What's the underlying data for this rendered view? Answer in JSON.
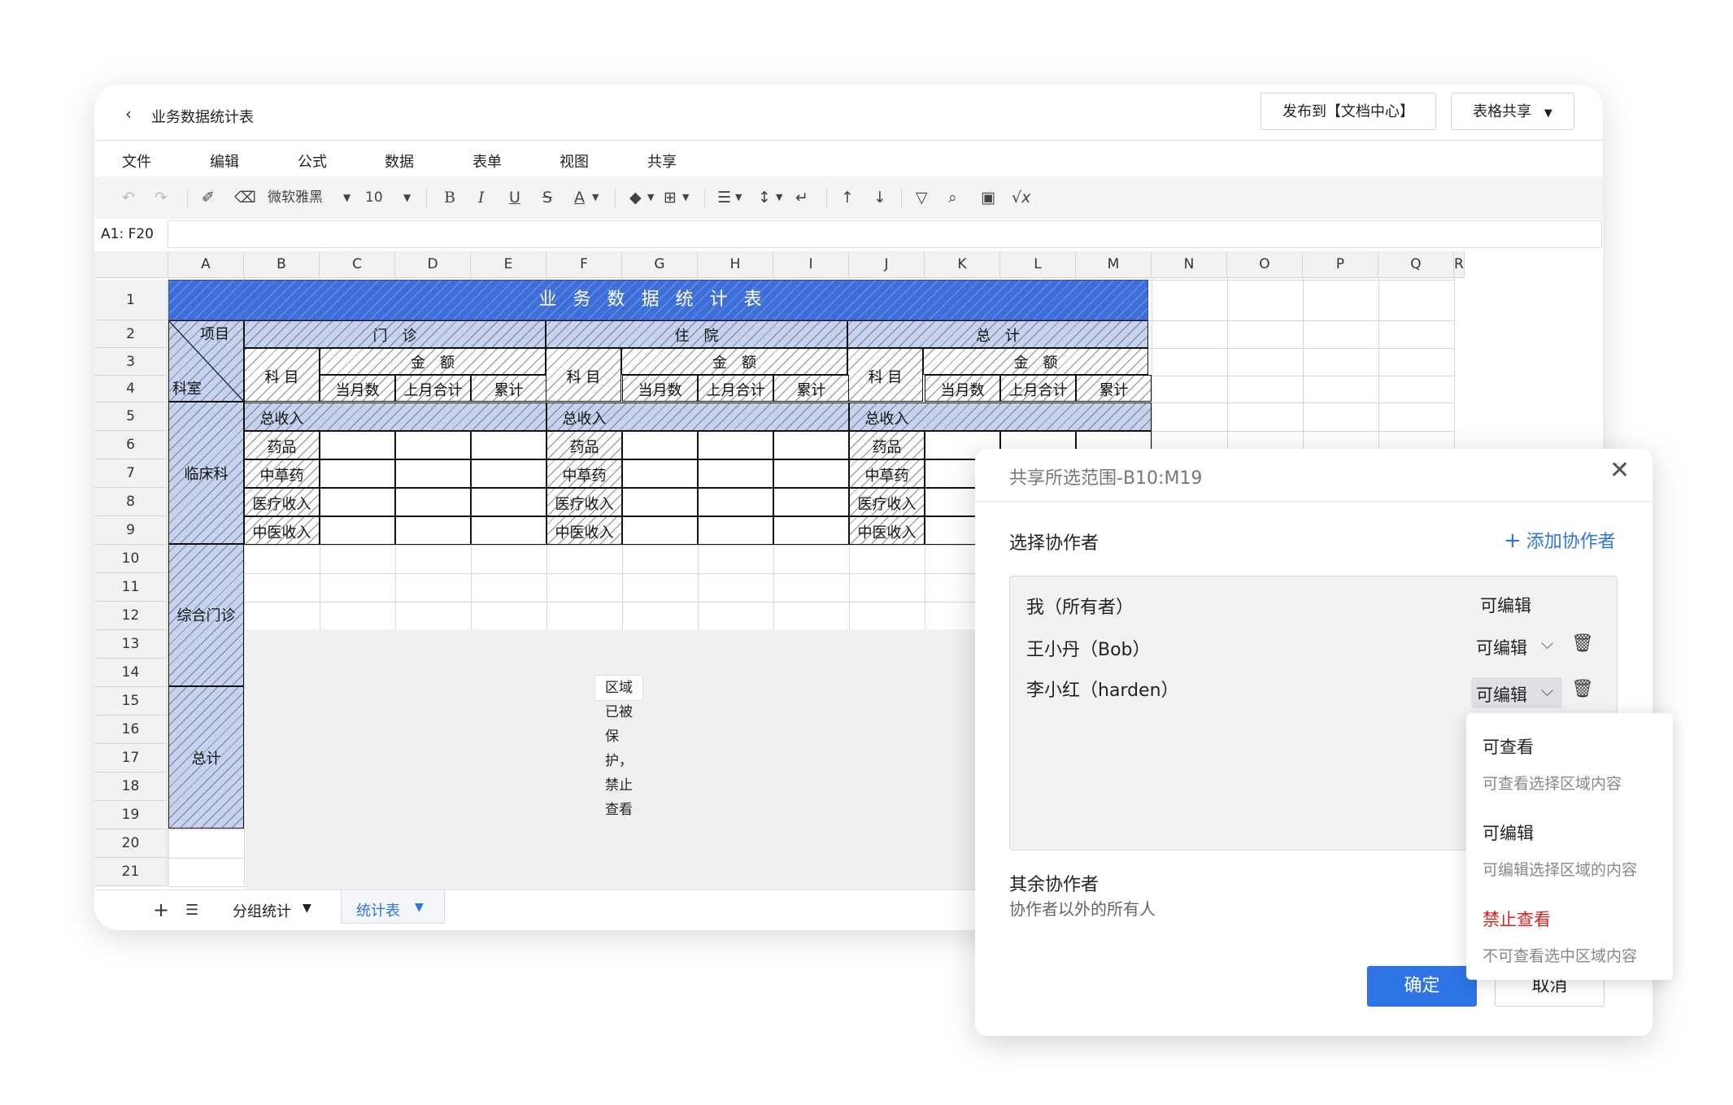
{
  "window": {
    "title": "业务数据统计表",
    "publish_label": "发布到【文档中心】",
    "share_label": "表格共享"
  },
  "menus": [
    "文件",
    "编辑",
    "公式",
    "数据",
    "表单",
    "视图",
    "共享"
  ],
  "toolbar": {
    "font_name": "微软雅黑",
    "font_size": "10"
  },
  "formula_bar": {
    "cell_ref": "A1: F20",
    "value": ""
  },
  "columns": [
    "A",
    "B",
    "C",
    "D",
    "E",
    "F",
    "G",
    "H",
    "I",
    "J",
    "K",
    "L",
    "M",
    "N",
    "O",
    "P",
    "Q",
    "R"
  ],
  "rows": [
    "1",
    "2",
    "3",
    "4",
    "5",
    "6",
    "7",
    "8",
    "9",
    "10",
    "11",
    "12",
    "13",
    "14",
    "15",
    "16",
    "17",
    "18",
    "19",
    "20",
    "21"
  ],
  "sheet": {
    "title": "业务数据统计表",
    "header_item": "项目",
    "header_dept": "科室",
    "section_outpatient": "门　诊",
    "section_inpatient": "住　院",
    "section_total": "总　计",
    "subject": "科 目",
    "amount": "金　额",
    "month": "当月数",
    "last_month": "上月合计",
    "cumulative": "累计",
    "total_income": "总收入",
    "items": [
      "药品",
      "中草药",
      "医疗收入",
      "中医收入"
    ],
    "dept_clinical": "临床科",
    "dept_general": "综合门诊",
    "dept_total": "总计",
    "protected_message": "区域已被保护，禁止查看"
  },
  "tabs": {
    "add": "+",
    "list": "☰",
    "tab1": "分组统计",
    "tab2": "统计表"
  },
  "dialog": {
    "title": "共享所选范围-B10:M19",
    "select_label": "选择协作者",
    "add_label": "添加协作者",
    "collaborators": [
      {
        "name": "我（所有者）",
        "permission": "可编辑"
      },
      {
        "name": "王小丹（Bob）",
        "permission": "可编辑"
      },
      {
        "name": "李小红（harden）",
        "permission": "可编辑"
      }
    ],
    "others_label": "其余协作者",
    "others_desc": "协作者以外的所有人",
    "confirm": "确定",
    "cancel": "取消"
  },
  "dropdown": {
    "options": [
      {
        "title": "可查看",
        "desc": "可查看选择区域内容",
        "color": "#222222"
      },
      {
        "title": "可编辑",
        "desc": "可编辑选择区域的内容",
        "color": "#222222"
      },
      {
        "title": "禁止查看",
        "desc": "不可查看选中区域内容",
        "color": "#e02020"
      }
    ]
  },
  "colors": {
    "accent": "#2f74e6",
    "header_blue": "#3e6fd9",
    "danger": "#e02020"
  }
}
